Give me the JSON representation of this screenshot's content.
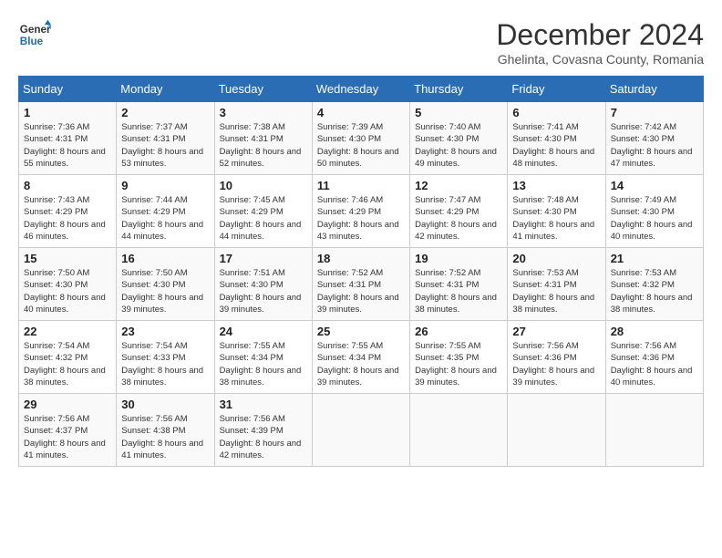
{
  "logo": {
    "line1": "General",
    "line2": "Blue"
  },
  "title": "December 2024",
  "subtitle": "Ghelinta, Covasna County, Romania",
  "weekdays": [
    "Sunday",
    "Monday",
    "Tuesday",
    "Wednesday",
    "Thursday",
    "Friday",
    "Saturday"
  ],
  "weeks": [
    [
      {
        "day": "1",
        "sunrise": "7:36 AM",
        "sunset": "4:31 PM",
        "daylight": "8 hours and 55 minutes."
      },
      {
        "day": "2",
        "sunrise": "7:37 AM",
        "sunset": "4:31 PM",
        "daylight": "8 hours and 53 minutes."
      },
      {
        "day": "3",
        "sunrise": "7:38 AM",
        "sunset": "4:31 PM",
        "daylight": "8 hours and 52 minutes."
      },
      {
        "day": "4",
        "sunrise": "7:39 AM",
        "sunset": "4:30 PM",
        "daylight": "8 hours and 50 minutes."
      },
      {
        "day": "5",
        "sunrise": "7:40 AM",
        "sunset": "4:30 PM",
        "daylight": "8 hours and 49 minutes."
      },
      {
        "day": "6",
        "sunrise": "7:41 AM",
        "sunset": "4:30 PM",
        "daylight": "8 hours and 48 minutes."
      },
      {
        "day": "7",
        "sunrise": "7:42 AM",
        "sunset": "4:30 PM",
        "daylight": "8 hours and 47 minutes."
      }
    ],
    [
      {
        "day": "8",
        "sunrise": "7:43 AM",
        "sunset": "4:29 PM",
        "daylight": "8 hours and 46 minutes."
      },
      {
        "day": "9",
        "sunrise": "7:44 AM",
        "sunset": "4:29 PM",
        "daylight": "8 hours and 44 minutes."
      },
      {
        "day": "10",
        "sunrise": "7:45 AM",
        "sunset": "4:29 PM",
        "daylight": "8 hours and 44 minutes."
      },
      {
        "day": "11",
        "sunrise": "7:46 AM",
        "sunset": "4:29 PM",
        "daylight": "8 hours and 43 minutes."
      },
      {
        "day": "12",
        "sunrise": "7:47 AM",
        "sunset": "4:29 PM",
        "daylight": "8 hours and 42 minutes."
      },
      {
        "day": "13",
        "sunrise": "7:48 AM",
        "sunset": "4:30 PM",
        "daylight": "8 hours and 41 minutes."
      },
      {
        "day": "14",
        "sunrise": "7:49 AM",
        "sunset": "4:30 PM",
        "daylight": "8 hours and 40 minutes."
      }
    ],
    [
      {
        "day": "15",
        "sunrise": "7:50 AM",
        "sunset": "4:30 PM",
        "daylight": "8 hours and 40 minutes."
      },
      {
        "day": "16",
        "sunrise": "7:50 AM",
        "sunset": "4:30 PM",
        "daylight": "8 hours and 39 minutes."
      },
      {
        "day": "17",
        "sunrise": "7:51 AM",
        "sunset": "4:30 PM",
        "daylight": "8 hours and 39 minutes."
      },
      {
        "day": "18",
        "sunrise": "7:52 AM",
        "sunset": "4:31 PM",
        "daylight": "8 hours and 39 minutes."
      },
      {
        "day": "19",
        "sunrise": "7:52 AM",
        "sunset": "4:31 PM",
        "daylight": "8 hours and 38 minutes."
      },
      {
        "day": "20",
        "sunrise": "7:53 AM",
        "sunset": "4:31 PM",
        "daylight": "8 hours and 38 minutes."
      },
      {
        "day": "21",
        "sunrise": "7:53 AM",
        "sunset": "4:32 PM",
        "daylight": "8 hours and 38 minutes."
      }
    ],
    [
      {
        "day": "22",
        "sunrise": "7:54 AM",
        "sunset": "4:32 PM",
        "daylight": "8 hours and 38 minutes."
      },
      {
        "day": "23",
        "sunrise": "7:54 AM",
        "sunset": "4:33 PM",
        "daylight": "8 hours and 38 minutes."
      },
      {
        "day": "24",
        "sunrise": "7:55 AM",
        "sunset": "4:34 PM",
        "daylight": "8 hours and 38 minutes."
      },
      {
        "day": "25",
        "sunrise": "7:55 AM",
        "sunset": "4:34 PM",
        "daylight": "8 hours and 39 minutes."
      },
      {
        "day": "26",
        "sunrise": "7:55 AM",
        "sunset": "4:35 PM",
        "daylight": "8 hours and 39 minutes."
      },
      {
        "day": "27",
        "sunrise": "7:56 AM",
        "sunset": "4:36 PM",
        "daylight": "8 hours and 39 minutes."
      },
      {
        "day": "28",
        "sunrise": "7:56 AM",
        "sunset": "4:36 PM",
        "daylight": "8 hours and 40 minutes."
      }
    ],
    [
      {
        "day": "29",
        "sunrise": "7:56 AM",
        "sunset": "4:37 PM",
        "daylight": "8 hours and 41 minutes."
      },
      {
        "day": "30",
        "sunrise": "7:56 AM",
        "sunset": "4:38 PM",
        "daylight": "8 hours and 41 minutes."
      },
      {
        "day": "31",
        "sunrise": "7:56 AM",
        "sunset": "4:39 PM",
        "daylight": "8 hours and 42 minutes."
      },
      null,
      null,
      null,
      null
    ]
  ]
}
